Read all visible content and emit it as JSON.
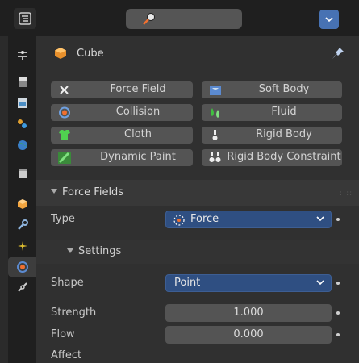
{
  "header": {
    "object_name": "Cube"
  },
  "physics_buttons": [
    {
      "label": "Force Field",
      "icon": "x-icon"
    },
    {
      "label": "Soft Body",
      "icon": "soft-body-icon"
    },
    {
      "label": "Collision",
      "icon": "collision-icon"
    },
    {
      "label": "Fluid",
      "icon": "fluid-icon"
    },
    {
      "label": "Cloth",
      "icon": "cloth-icon"
    },
    {
      "label": "Rigid Body",
      "icon": "rigid-body-icon"
    },
    {
      "label": "Dynamic Paint",
      "icon": "dynamic-paint-icon"
    },
    {
      "label": "Rigid Body Constraint",
      "icon": "rigid-body-constraint-icon"
    }
  ],
  "force_fields": {
    "title": "Force Fields",
    "type_label": "Type",
    "type_value": "Force",
    "settings_title": "Settings",
    "shape_label": "Shape",
    "shape_value": "Point",
    "strength_label": "Strength",
    "strength_value": "1.000",
    "flow_label": "Flow",
    "flow_value": "0.000",
    "affect_label": "Affect"
  },
  "colors": {
    "accent": "#4772b3",
    "dropdown_bg": "#2f4f82",
    "panel_bg": "#303030",
    "button_bg": "#545454"
  }
}
